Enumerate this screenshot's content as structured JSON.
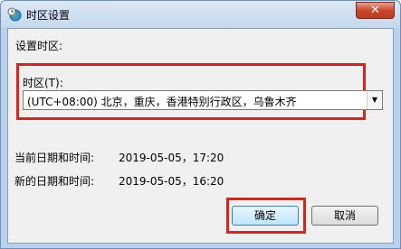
{
  "window": {
    "title": "时区设置",
    "close_glyph": "✕"
  },
  "section": {
    "label": "设置时区:"
  },
  "timezone": {
    "label": "时区(T):",
    "selected": "(UTC+08:00) 北京，重庆，香港特别行政区，乌鲁木齐",
    "arrow": "▼"
  },
  "info": {
    "current_label": "当前日期和时间:",
    "current_value": "2019-05-05，17:20",
    "new_label": "新的日期和时间:",
    "new_value": "2019-05-05，16:20"
  },
  "buttons": {
    "ok": "确定",
    "cancel": "取消"
  },
  "colors": {
    "highlight": "#e0201b",
    "titlebar": "#c4d8ed"
  },
  "icons": {
    "app": "clock-globe-icon",
    "close": "close-icon"
  }
}
